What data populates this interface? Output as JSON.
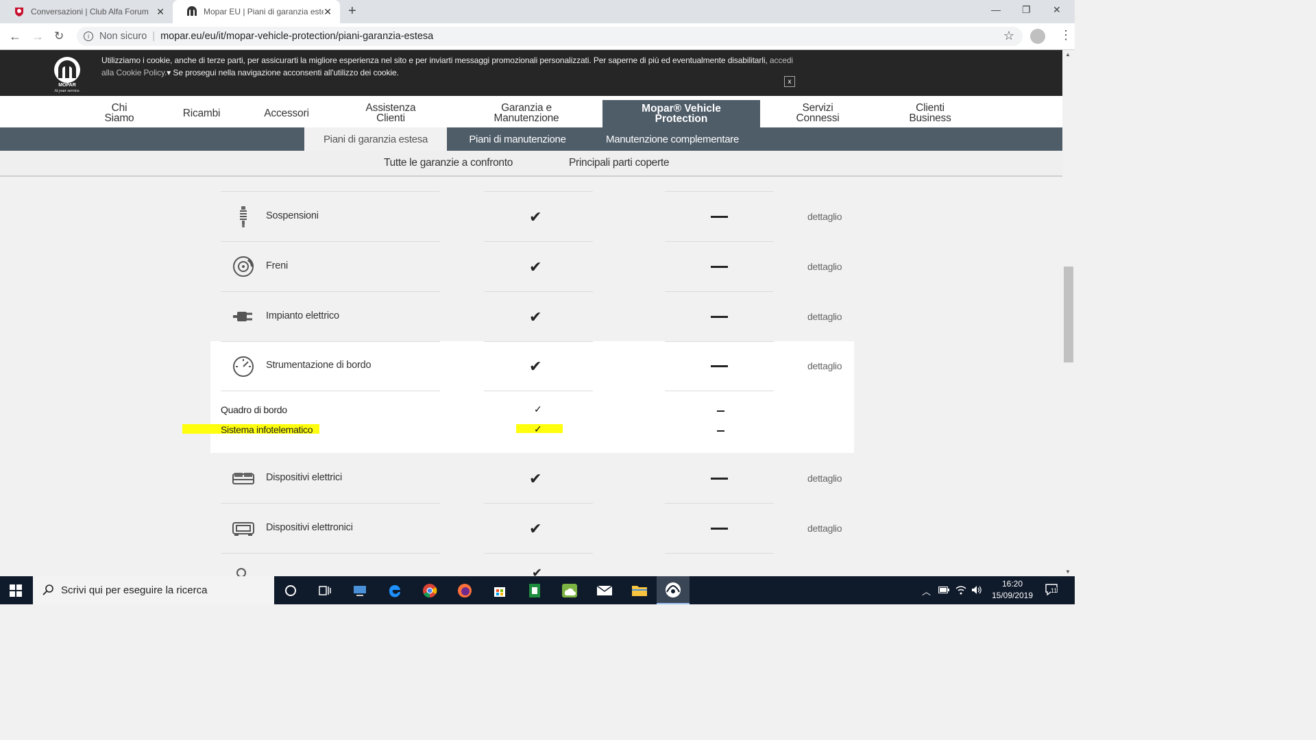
{
  "browser": {
    "tabs": [
      {
        "title": "Conversazioni | Club Alfa Forum",
        "favicon": "alfa-romeo-icon"
      },
      {
        "title": "Mopar EU | Piani di garanzia este",
        "favicon": "mopar-icon",
        "active": true
      }
    ],
    "address": {
      "security_label": "Non sicuro",
      "url": "mopar.eu/eu/it/mopar-vehicle-protection/piani-garanzia-estesa"
    }
  },
  "cookie_banner": {
    "text": "Utilizziamo i cookie, anche di terze parti, per assicurarti la migliore esperienza nel sito e per inviarti messaggi promozionali personalizzati. Per saperne di più ed eventualmente disabilitarli, ",
    "link": "accedi alla Cookie Policy.",
    "text2": " Se prosegui nella navigazione acconsenti all'utilizzo dei cookie.",
    "close": "x"
  },
  "logo": {
    "brand": "MOPAR",
    "tagline": "At your service."
  },
  "main_nav": {
    "items": [
      {
        "line1": "Chi",
        "line2": "Siamo"
      },
      {
        "line1": "Ricambi",
        "line2": ""
      },
      {
        "line1": "Accessori",
        "line2": ""
      },
      {
        "line1": "Assistenza",
        "line2": "Clienti"
      },
      {
        "line1": "Garanzia e",
        "line2": "Manutenzione"
      },
      {
        "line1": "Mopar® Vehicle",
        "line2": "Protection"
      },
      {
        "line1": "Servizi",
        "line2": "Connessi"
      },
      {
        "line1": "Clienti",
        "line2": "Business"
      }
    ]
  },
  "sub_nav": {
    "items": [
      "Piani di garanzia estesa",
      "Piani di manutenzione",
      "Manutenzione complementare"
    ]
  },
  "third_nav": {
    "items": [
      "Tutte le garanzie a confronto",
      "Principali parti coperte"
    ]
  },
  "table": {
    "rows": [
      {
        "label": "Sospensioni",
        "icon": "suspension-icon",
        "detail": "dettaglio"
      },
      {
        "label": "Freni",
        "icon": "brake-disc-icon",
        "detail": "dettaglio"
      },
      {
        "label": "Impianto elettrico",
        "icon": "electric-plug-icon",
        "detail": "dettaglio"
      },
      {
        "label": "Strumentazione di bordo",
        "icon": "speedometer-icon",
        "detail": "dettaglio"
      },
      {
        "label": "Dispositivi elettrici",
        "icon": "electric-devices-icon",
        "detail": "dettaglio"
      },
      {
        "label": "Dispositivi elettronici",
        "icon": "electronic-devices-icon",
        "detail": "dettaglio"
      }
    ],
    "subrows": [
      {
        "label": "Quadro di bordo"
      },
      {
        "label": "Sistema infotelematico"
      }
    ]
  },
  "taskbar": {
    "search_placeholder": "Scrivi qui per eseguire la ricerca",
    "time": "16:20",
    "date": "15/09/2019",
    "notifications": "11"
  },
  "colors": {
    "nav_active": "#4f5d69",
    "highlight": "#ffff00",
    "taskbar": "#0f1a2b"
  }
}
